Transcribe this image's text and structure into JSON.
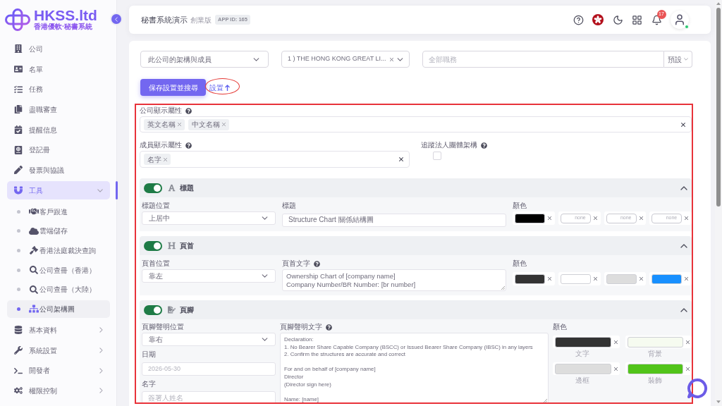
{
  "sidebar": {
    "logo": {
      "name": "HKSS.ltd",
      "tagline": "香港優軟·秘書系統"
    },
    "items": [
      {
        "label": "公司",
        "selected": false
      },
      {
        "label": "名單",
        "selected": false
      },
      {
        "label": "任務",
        "selected": false
      },
      {
        "label": "盡職審查",
        "selected": false
      },
      {
        "label": "提醒信息",
        "selected": false
      },
      {
        "label": "登記冊",
        "selected": false
      },
      {
        "label": "發票與協議",
        "selected": false
      },
      {
        "label": "工具",
        "selected": true,
        "expanded": true,
        "children": [
          {
            "label": "客戶跟進",
            "selected": false
          },
          {
            "label": "雲端儲存",
            "selected": false
          },
          {
            "label": "香港法庭裁決查詢",
            "selected": false
          },
          {
            "label": "公司查冊（香港）",
            "selected": false
          },
          {
            "label": "公司查冊（大陸）",
            "selected": false
          },
          {
            "label": "公司架構圖",
            "selected": true
          }
        ]
      },
      {
        "label": "基本資料",
        "selected": false,
        "expanded": false
      },
      {
        "label": "系統設置",
        "selected": false,
        "expanded": false
      },
      {
        "label": "開發者",
        "selected": false,
        "expanded": false
      },
      {
        "label": "權限控制",
        "selected": false,
        "expanded": false
      }
    ]
  },
  "header": {
    "title": "秘書系統演示",
    "edition": "創業版",
    "app_id": "APP ID: 165",
    "notification_count": "17"
  },
  "filters": {
    "structure_select": {
      "value": "此公司的架構與成員"
    },
    "company_select": {
      "value": "1 ) THE HONG KONG GREAT LI..."
    },
    "role_field": {
      "placeholder": "全部職務",
      "preset": "預設"
    }
  },
  "actions": {
    "save_button": "保存設置並搜尋",
    "settings_link": "設置"
  },
  "display": {
    "company_attributes": {
      "label": "公司顯示屬性",
      "tags": [
        "英文名稱",
        "中文名稱"
      ]
    },
    "member_attributes": {
      "label": "成員顯示屬性",
      "tags": [
        "名字"
      ]
    },
    "track_corporate": {
      "label": "追蹤法人團體架構",
      "checked": false
    }
  },
  "sections": [
    {
      "kind": "title",
      "title": "標題",
      "on": true,
      "expanded": true,
      "position": {
        "label": "標題位置",
        "value": "上居中"
      },
      "text": {
        "label": "標題",
        "help": false,
        "value": "Structure Chart 關係結構圖"
      },
      "colors": {
        "label": "顏色",
        "swatches": [
          {
            "kind": "color",
            "color": "#000000"
          },
          {
            "kind": "empty",
            "placeholder": "none"
          },
          {
            "kind": "empty",
            "placeholder": "none"
          },
          {
            "kind": "empty",
            "placeholder": "none"
          }
        ]
      }
    },
    {
      "kind": "header",
      "title": "頁首",
      "on": true,
      "expanded": true,
      "position": {
        "label": "頁首位置",
        "value": "靠左"
      },
      "text": {
        "label": "頁首文字",
        "help": true,
        "value": "Ownership Chart of [company name]\nCompany Number/BR Number: [br number]"
      },
      "colors": {
        "label": "顏色",
        "swatches": [
          {
            "kind": "color",
            "color": "#333333"
          },
          {
            "kind": "color",
            "color": "#ffffff"
          },
          {
            "kind": "color",
            "color": "#dddddd"
          },
          {
            "kind": "color",
            "color": "#1890ff"
          }
        ]
      }
    },
    {
      "kind": "footer",
      "title": "頁腳",
      "on": true,
      "expanded": true,
      "position": {
        "label": "頁腳聲明位置",
        "value": "靠右"
      },
      "date": {
        "label": "日期",
        "placeholder": "2026-05-30"
      },
      "signer": {
        "label": "名字",
        "placeholder": "簽署人姓名"
      },
      "text": {
        "label": "頁腳聲明文字",
        "help": true,
        "value": "Declaration:\n1. No Bearer Share Capable Company (BSCC) or Issued Bearer Share Company (IBSC) in any layers\n2. Confirm the structures are accurate and correct\n\nFor and on behalf of [company name]\nDirector\n(Director sign here)\n\nName: [name]"
      },
      "colors": {
        "label": "顏色",
        "swatches": [
          {
            "kind": "color",
            "color": "#333333",
            "caption": "文字"
          },
          {
            "kind": "color",
            "color": "#f6fbf0",
            "caption": "背景"
          },
          {
            "kind": "color",
            "color": "#dddddd",
            "caption": "邊框"
          },
          {
            "kind": "color",
            "color": "#52c41a",
            "caption": "裝飾"
          }
        ]
      }
    }
  ]
}
